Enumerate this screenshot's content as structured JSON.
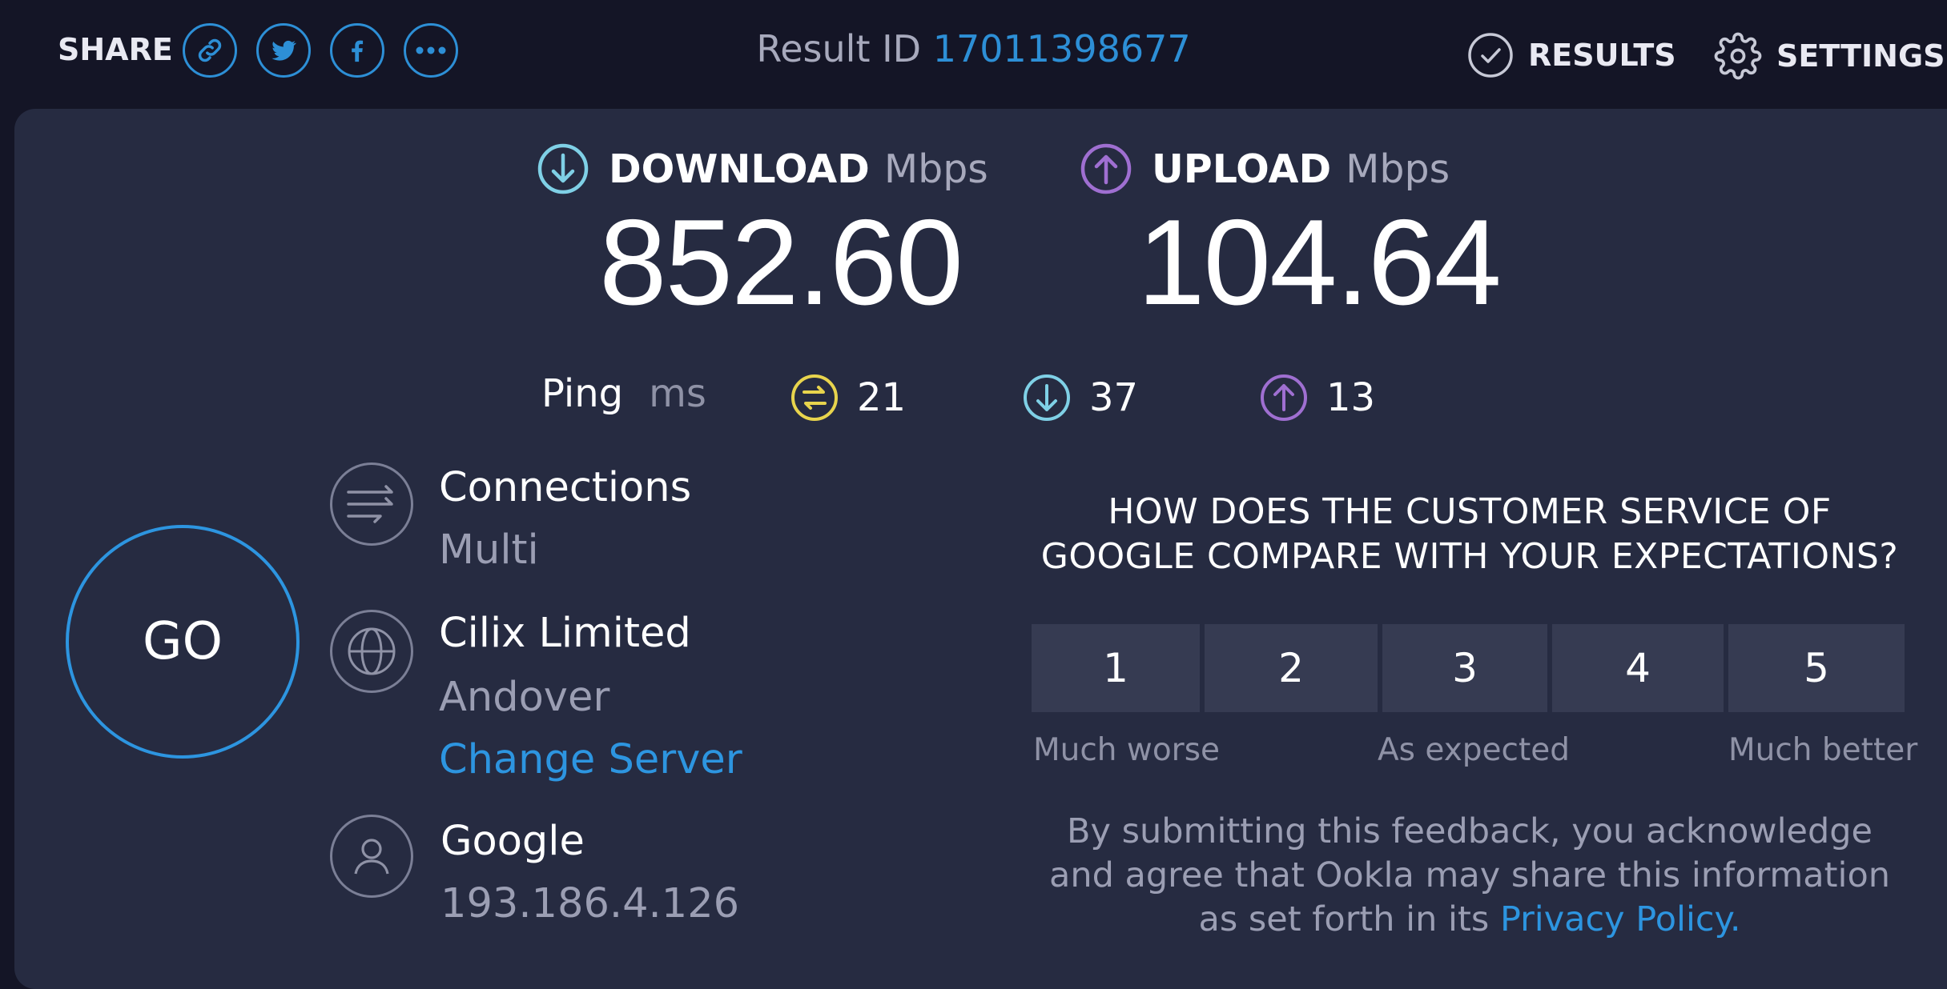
{
  "header": {
    "share_label": "SHARE",
    "share_buttons": [
      "link-icon",
      "twitter-icon",
      "facebook-icon",
      "more-icon"
    ],
    "result_id_label": "Result ID",
    "result_id": "17011398677",
    "results_label": "RESULTS",
    "settings_label": "SETTINGS"
  },
  "download": {
    "label": "DOWNLOAD",
    "unit": "Mbps",
    "value": "852.60",
    "color": "#7fd0e6"
  },
  "upload": {
    "label": "UPLOAD",
    "unit": "Mbps",
    "value": "104.64",
    "color": "#9f6fd1"
  },
  "ping": {
    "label": "Ping",
    "unit": "ms",
    "idle": "21",
    "download": "37",
    "upload": "13",
    "idle_color": "#e8d44d"
  },
  "go_label": "GO",
  "connections": {
    "title": "Connections",
    "value": "Multi"
  },
  "server": {
    "name": "Cilix Limited",
    "location": "Andover",
    "change_label": "Change Server"
  },
  "provider": {
    "name": "Google",
    "ip": "193.186.4.126"
  },
  "survey": {
    "question": "HOW DOES THE CUSTOMER SERVICE OF GOOGLE COMPARE WITH YOUR EXPECTATIONS?",
    "options": [
      "1",
      "2",
      "3",
      "4",
      "5"
    ],
    "low_label": "Much worse",
    "mid_label": "As expected",
    "high_label": "Much better",
    "disclaimer": "By submitting this feedback, you acknowledge and agree that Ookla may share this information as set forth in its",
    "privacy_link": "Privacy Policy."
  },
  "colors": {
    "accent": "#2d95e0",
    "background": "#141526",
    "panel": "#262b41"
  }
}
